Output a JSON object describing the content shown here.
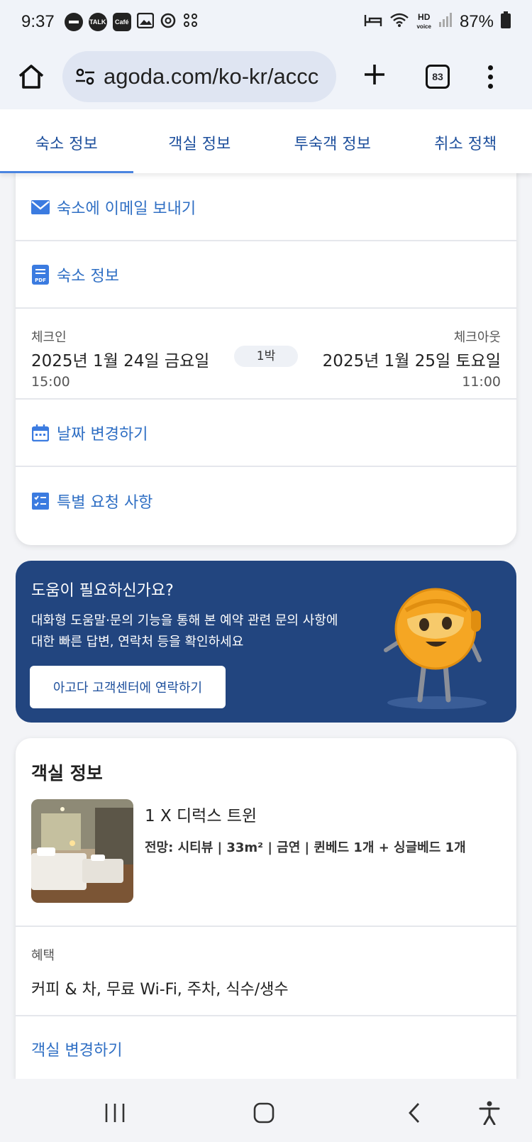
{
  "status_bar": {
    "time": "9:37",
    "icons": [
      "minus-circle-icon",
      "talk-icon",
      "cafe-icon",
      "image-icon",
      "threads-icon",
      "grid-icon"
    ],
    "talk_label": "TALK",
    "cafe_label": "Café",
    "hd_label": "HD",
    "voice_label": "voice",
    "battery": "87%"
  },
  "browser": {
    "url": "agoda.com/ko-kr/accc",
    "tab_count": "83"
  },
  "tabs": [
    {
      "label": "숙소 정보",
      "active": true
    },
    {
      "label": "객실 정보",
      "active": false
    },
    {
      "label": "투숙객 정보",
      "active": false
    },
    {
      "label": "취소 정책",
      "active": false
    }
  ],
  "property_card": {
    "email_label": "숙소에 이메일 보내기",
    "info_label": "숙소 정보",
    "pdf_badge": "PDF",
    "checkin_label": "체크인",
    "checkin_date": "2025년 1월 24일 금요일",
    "checkin_time": "15:00",
    "nights": "1박",
    "checkout_label": "체크아웃",
    "checkout_date": "2025년 1월 25일 토요일",
    "checkout_time": "11:00",
    "change_dates_label": "날짜 변경하기",
    "special_requests_label": "특별 요청 사항"
  },
  "help_banner": {
    "title": "도움이 필요하신가요?",
    "description": "대화형 도움말·문의 기능을 통해 본 예약 관련 문의 사항에 대한 빠른 답변, 연락처 등을 확인하세요",
    "button_label": "아고다 고객센터에 연락하기",
    "background_color": "#22457f"
  },
  "room_card": {
    "title": "객실 정보",
    "room_name": "1 X 디럭스 트윈",
    "room_meta": "전망: 시티뷰 | 33m² | 금연 | 퀸베드 1개 + 싱글베드 1개",
    "perks_label": "혜택",
    "perks_value": "커피 & 차, 무료 Wi-Fi, 주차, 식수/생수",
    "change_room_label": "객실 변경하기"
  },
  "colors": {
    "link_blue": "#2f6fc4",
    "tab_blue": "#1d4f9c",
    "active_underline": "#4a84e0"
  }
}
